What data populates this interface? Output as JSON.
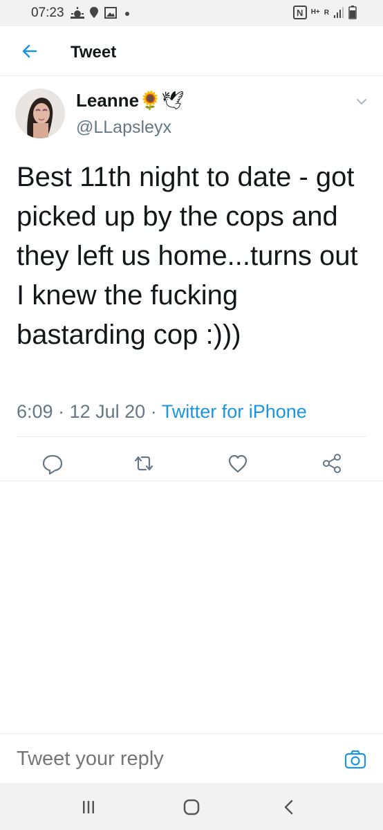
{
  "status_bar": {
    "time": "07:23",
    "network_label": "H+",
    "roaming_label": "R"
  },
  "header": {
    "title": "Tweet"
  },
  "tweet": {
    "display_name": "Leanne",
    "name_emojis": "🌻🕊",
    "handle": "@LLapsleyx",
    "text": "Best 11th night to date - got picked up by the cops and they left us home...turns out I knew the fucking bastarding cop :)))",
    "time": "6:09",
    "date": "12 Jul 20",
    "source": "Twitter for iPhone",
    "separator": "·"
  },
  "reply": {
    "placeholder": "Tweet your reply"
  },
  "colors": {
    "accent": "#1b95e0",
    "secondary_text": "#657786",
    "primary_text": "#14171a",
    "divider": "#e6ecf0"
  },
  "icons": [
    "back-arrow-icon",
    "chevron-down-icon",
    "reply-icon",
    "retweet-icon",
    "like-icon",
    "share-icon",
    "camera-icon",
    "recent-apps-icon",
    "home-icon",
    "back-nav-icon"
  ]
}
